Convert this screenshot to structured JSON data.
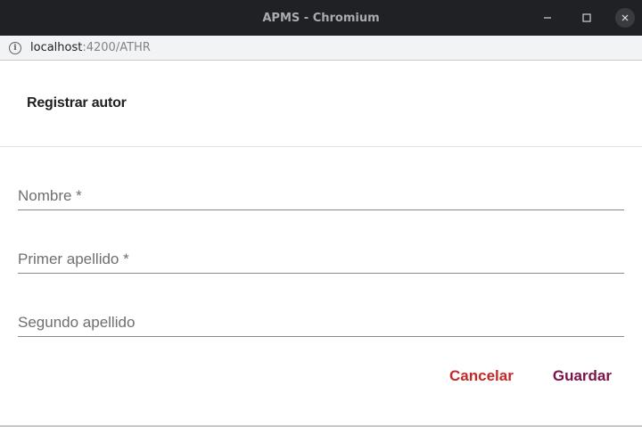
{
  "window": {
    "title": "APMS - Chromium"
  },
  "addressbar": {
    "host": "localhost",
    "path": ":4200/ATHR"
  },
  "dialog": {
    "title": "Registrar autor",
    "fields": [
      {
        "label": "Nombre *",
        "value": ""
      },
      {
        "label": "Primer apellido *",
        "value": ""
      },
      {
        "label": "Segundo apellido",
        "value": ""
      }
    ],
    "cancel_label": "Cancelar",
    "save_label": "Guardar"
  },
  "colors": {
    "cancel": "#c62828",
    "save": "#7b1348",
    "titlebar": "#202124"
  }
}
